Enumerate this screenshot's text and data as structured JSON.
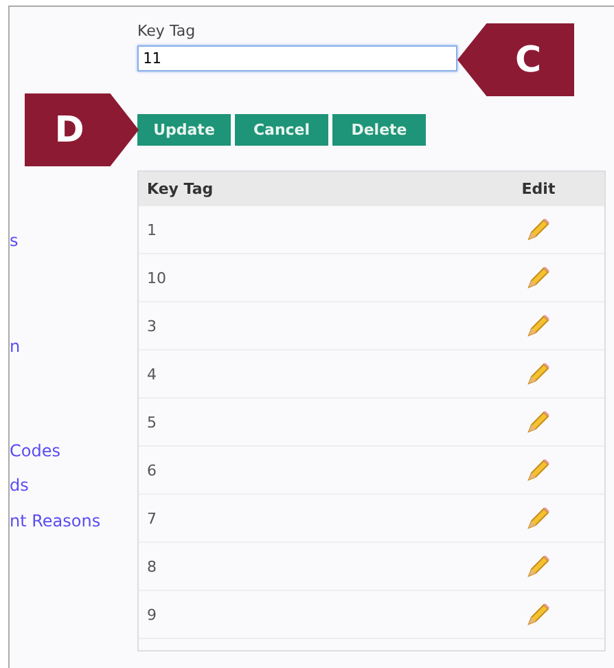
{
  "sidebar": {
    "links": [
      "s",
      "n",
      "Codes",
      "ds",
      "nt Reasons"
    ]
  },
  "form": {
    "label": "Key Tag",
    "value": "11",
    "focused": true,
    "buttons": [
      "Update",
      "Cancel",
      "Delete"
    ]
  },
  "callouts": [
    {
      "letter": "C",
      "kind": "left"
    },
    {
      "letter": "D",
      "kind": "right"
    }
  ],
  "table": {
    "columns": [
      "Key Tag",
      "Edit"
    ],
    "rows": [
      {
        "key_tag": "1"
      },
      {
        "key_tag": "10"
      },
      {
        "key_tag": "3"
      },
      {
        "key_tag": "4"
      },
      {
        "key_tag": "5"
      },
      {
        "key_tag": "6"
      },
      {
        "key_tag": "7"
      },
      {
        "key_tag": "8"
      },
      {
        "key_tag": "9"
      }
    ]
  }
}
